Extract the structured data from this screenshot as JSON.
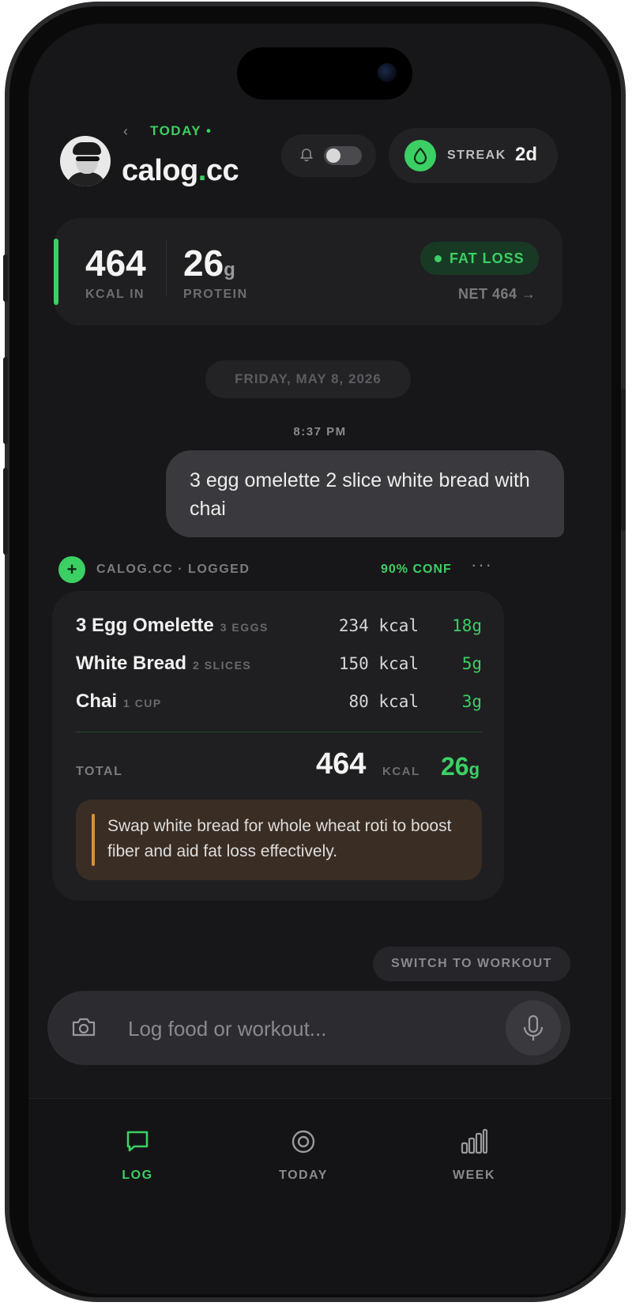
{
  "header": {
    "back_arrow": "‹",
    "today_label": "TODAY •",
    "brand_name": "calog",
    "brand_dot": ".",
    "brand_tld": "cc",
    "streak_label": "STREAK",
    "streak_value": "2d"
  },
  "summary": {
    "kcal_value": "464",
    "kcal_label": "KCAL IN",
    "protein_value": "26",
    "protein_unit": "g",
    "protein_label": "PROTEIN",
    "goal_badge": "FAT LOSS",
    "net_text": "NET 464 →"
  },
  "chat": {
    "date_label": "FRIDAY, MAY 8, 2026",
    "time_label": "8:37 PM",
    "user_message": "3 egg omelette 2 slice white bread with chai",
    "bot_icon": "+",
    "bot_name": "CALOG.CC · LOGGED",
    "confidence": "90% CONF",
    "more": "···"
  },
  "log_card": {
    "items": [
      {
        "name": "3 Egg Omelette",
        "qty": "3 EGGS",
        "kcal": "234 kcal",
        "protein": "18g"
      },
      {
        "name": "White Bread",
        "qty": "2 SLICES",
        "kcal": "150 kcal",
        "protein": "5g"
      },
      {
        "name": "Chai",
        "qty": "1 CUP",
        "kcal": "80 kcal",
        "protein": "3g"
      }
    ],
    "total_label": "TOTAL",
    "total_kcal": "464",
    "total_kcal_label": "KCAL",
    "total_protein": "26",
    "total_protein_unit": "g",
    "tip": "Swap white bread for whole wheat roti to boost fiber and aid fat loss effectively."
  },
  "switch_button": "SWITCH TO WORKOUT",
  "input": {
    "placeholder": "Log food or workout...",
    "value": ""
  },
  "tabs": [
    {
      "label": "LOG",
      "icon": "chat-bubble-icon",
      "active": true
    },
    {
      "label": "TODAY",
      "icon": "target-icon",
      "active": false
    },
    {
      "label": "WEEK",
      "icon": "bar-chart-icon",
      "active": false
    }
  ],
  "colors": {
    "accent": "#3ccf64",
    "background": "#171719",
    "card": "#1f1f22",
    "tip_bg": "#3a2d23",
    "tip_accent": "#d6923a"
  }
}
